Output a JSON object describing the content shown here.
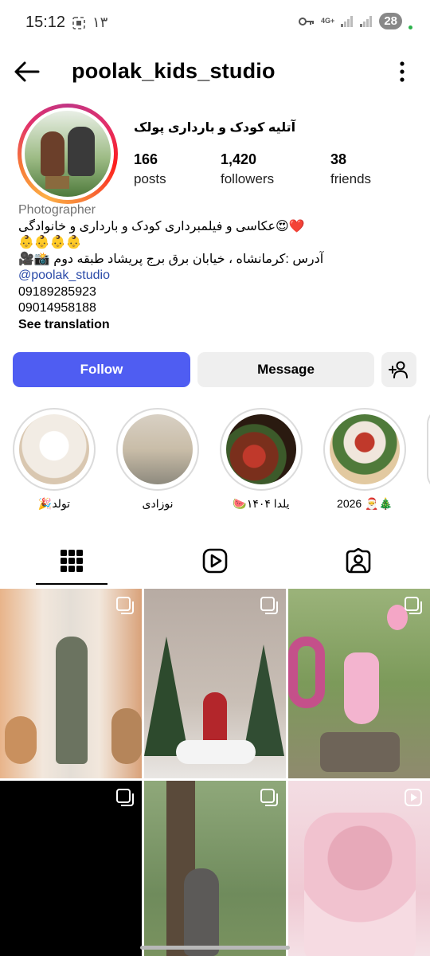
{
  "status_bar": {
    "time": "15:12",
    "notification_count": "۱۳",
    "network": "4G+",
    "battery": "28"
  },
  "header": {
    "username": "poolak_kids_studio"
  },
  "profile": {
    "full_name": "آتلیه کودک و بارداری پولک",
    "stats": [
      {
        "value": "166",
        "label": "posts"
      },
      {
        "value": "1,420",
        "label": "followers"
      },
      {
        "value": "38",
        "label": "friends"
      }
    ],
    "category": "Photographer",
    "bio_lines": [
      "❤️😍عکاسی و فیلمبرداری کودک و بارداری و خانوادگی",
      "👶👶👶👶",
      "آدرس :کرمانشاه ، خیابان برق برج پریشاد طبقه دوم 📸🎥"
    ],
    "mention": "@poolak_studio",
    "phones": [
      "09189285923",
      "09014958188"
    ],
    "see_translation": "See translation"
  },
  "actions": {
    "follow": "Follow",
    "message": "Message"
  },
  "highlights": [
    {
      "label": "تولد🎉"
    },
    {
      "label": "نوزادی"
    },
    {
      "label": "یلدا ۱۴۰۴🍉"
    },
    {
      "label": "2026 🎅🎄"
    }
  ],
  "tabs": [
    "posts-grid",
    "reels",
    "tagged"
  ],
  "colors": {
    "follow_button": "#4f5df2",
    "secondary_button": "#efefef",
    "category_text": "#737373",
    "link": "#2a4aa8"
  },
  "icons": {
    "back": "arrow-left",
    "more": "vertical-dots",
    "add_user": "person-plus",
    "grid": "grid-3x3",
    "reels": "play-square",
    "tagged": "person-square",
    "multi_post": "stacked-squares",
    "reel_post": "play-square"
  }
}
